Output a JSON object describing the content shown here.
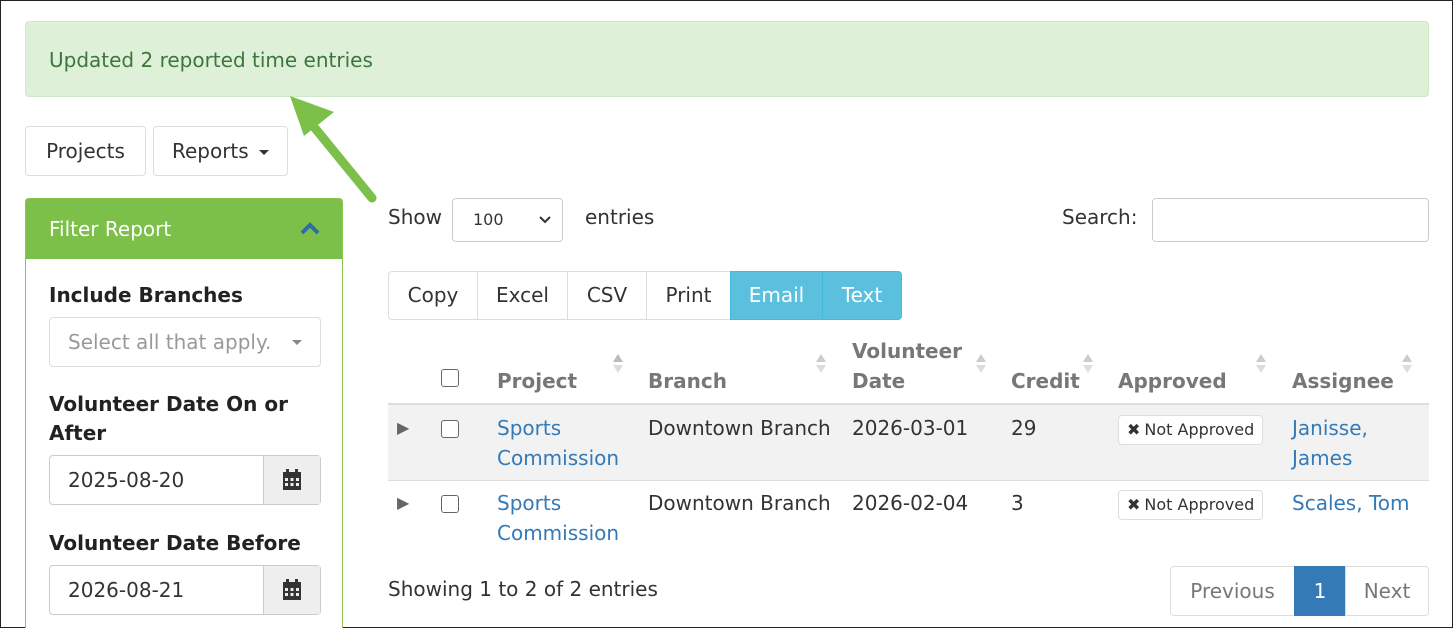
{
  "alert": {
    "message": "Updated 2 reported time entries"
  },
  "nav": {
    "projects_label": "Projects",
    "reports_label": "Reports"
  },
  "filter": {
    "title": "Filter Report",
    "branches_label": "Include Branches",
    "branches_placeholder": "Select all that apply.",
    "date_after_label": "Volunteer Date On or After",
    "date_after_value": "2025-08-20",
    "date_before_label": "Volunteer Date Before",
    "date_before_value": "2026-08-21"
  },
  "table_controls": {
    "show_label": "Show",
    "page_size": "100",
    "entries_label": "entries",
    "search_label": "Search:",
    "buttons": [
      "Copy",
      "Excel",
      "CSV",
      "Print",
      "Email",
      "Text"
    ]
  },
  "columns": {
    "project": "Project",
    "branch": "Branch",
    "volunteer_date_1": "Volunteer",
    "volunteer_date_2": "Date",
    "credit": "Credit",
    "approved": "Approved",
    "assignee": "Assignee"
  },
  "rows": [
    {
      "project_1": "Sports",
      "project_2": "Commission",
      "branch": "Downtown Branch",
      "date": "2026-03-01",
      "credit": "29",
      "approved": "Not Approved",
      "assignee_1": "Janisse,",
      "assignee_2": "James"
    },
    {
      "project_1": "Sports",
      "project_2": "Commission",
      "branch": "Downtown Branch",
      "date": "2026-02-04",
      "credit": "3",
      "approved": "Not Approved",
      "assignee_1": "Scales, Tom",
      "assignee_2": ""
    }
  ],
  "footer": {
    "info": "Showing 1 to 2 of 2 entries",
    "previous": "Previous",
    "page": "1",
    "next": "Next"
  },
  "colors": {
    "alert_bg": "#dff0d8",
    "panel_header": "#7cc04a",
    "arrow": "#7cc04a",
    "info_button": "#5bc0de",
    "link": "#337ab7",
    "active_page": "#337ab7"
  }
}
